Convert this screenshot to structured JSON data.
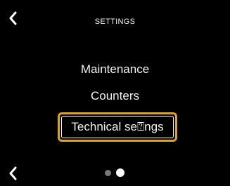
{
  "header": {
    "title": "SETTINGS",
    "back_icon": "chevron-left-icon"
  },
  "menu": {
    "items": [
      {
        "label": "Maintenance",
        "selected": false
      },
      {
        "label": "Counters",
        "selected": false
      },
      {
        "label": "Technical se⍰ngs",
        "selected": true
      }
    ]
  },
  "footer": {
    "back_icon": "chevron-left-icon",
    "page_count": 2,
    "current_page": 2
  },
  "colors": {
    "background": "#000000",
    "highlight": "#e0a31e",
    "text": "#f2f2f2",
    "dot_inactive": "#7a7a7a",
    "dot_active": "#ffffff"
  }
}
